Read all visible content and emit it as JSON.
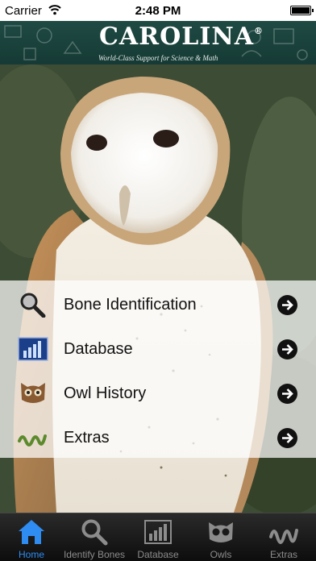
{
  "status_bar": {
    "carrier": "Carrier",
    "time": "2:48 PM",
    "wifi_icon": "wifi-icon",
    "battery_icon": "battery-icon"
  },
  "banner": {
    "logo": "CAROLINA",
    "registered": "®",
    "tagline": "World-Class Support for Science & Math"
  },
  "menu": {
    "items": [
      {
        "label": "Bone Identification",
        "icon": "magnifier-icon"
      },
      {
        "label": "Database",
        "icon": "bar-chart-icon"
      },
      {
        "label": "Owl History",
        "icon": "owl-face-icon"
      },
      {
        "label": "Extras",
        "icon": "squiggle-icon"
      }
    ],
    "arrow_icon": "arrow-right-icon"
  },
  "tabbar": {
    "tabs": [
      {
        "label": "Home",
        "icon": "home-icon",
        "active": true
      },
      {
        "label": "Identify Bones",
        "icon": "search-icon",
        "active": false
      },
      {
        "label": "Database",
        "icon": "bar-chart-icon",
        "active": false
      },
      {
        "label": "Owls",
        "icon": "owl-face-icon",
        "active": false
      },
      {
        "label": "Extras",
        "icon": "squiggle-icon",
        "active": false
      }
    ],
    "active_color": "#2f8cf0",
    "inactive_color": "#8c8c8c"
  },
  "colors": {
    "banner": "#1f4a43",
    "tabbar": "#1a1a1a"
  }
}
